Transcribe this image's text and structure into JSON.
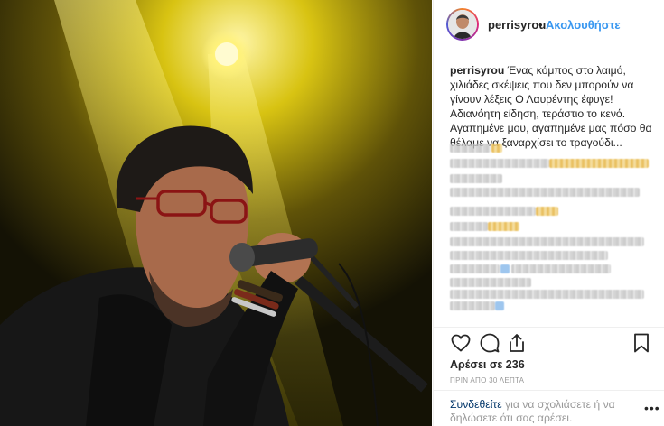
{
  "header": {
    "username": "perrisyrou",
    "separator": "•",
    "follow_label": "Ακολουθήστε"
  },
  "caption": {
    "username": "perrisyrou",
    "text": "Ένας κόμπος στο λαιμό, χιλιάδες σκέψεις που δεν μπορούν να γίνουν λέξεις Ο Λαυρέντης έφυγε! Αδιανόητη είδηση, τεράστιο το κενό. Αγαπημένε μου, αγαπημένε μας πόσο θα θέλαμε να ξαναρχίσει το τραγούδι..."
  },
  "actions": {
    "icons": [
      "heart-icon",
      "comment-icon",
      "share-icon",
      "bookmark-icon"
    ]
  },
  "likes_label": "Αρέσει σε 236",
  "timestamp": "ΠΡΙΝ ΑΠΟ 30 ΛΕΠΤΑ",
  "comment_prompt": {
    "login_label": "Συνδεθείτε",
    "rest": " για να σχολιάσετε ή να δηλώσετε ότι σας αρέσει."
  },
  "more_label": "•••",
  "colors": {
    "accent": "#3897f0",
    "text": "#262626",
    "muted": "#999999",
    "link": "#003569"
  }
}
